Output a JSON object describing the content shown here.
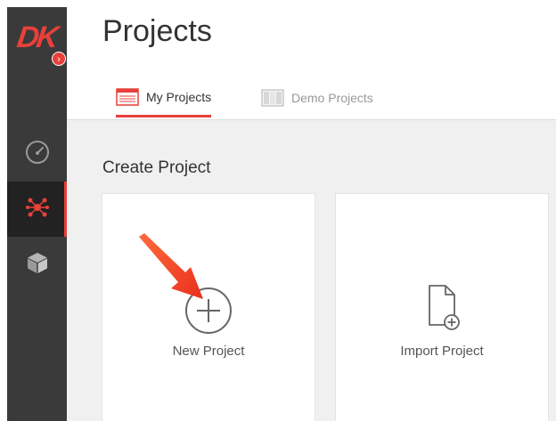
{
  "sidebar": {
    "logo_text": "DK",
    "collapse_icon": "chevron-right-icon",
    "items": [
      {
        "name": "dashboard",
        "icon": "speedometer-icon",
        "active": false
      },
      {
        "name": "projects",
        "icon": "network-nodes-icon",
        "active": true
      },
      {
        "name": "models",
        "icon": "cube-icon",
        "active": false
      }
    ]
  },
  "header": {
    "title": "Projects",
    "tabs": [
      {
        "label": "My Projects",
        "icon": "table-icon",
        "active": true
      },
      {
        "label": "Demo Projects",
        "icon": "columns-icon",
        "active": false
      }
    ]
  },
  "main": {
    "section_title": "Create Project",
    "cards": [
      {
        "label": "New Project",
        "icon": "plus-circle-icon"
      },
      {
        "label": "Import Project",
        "icon": "file-plus-icon"
      }
    ]
  },
  "colors": {
    "accent": "#e8403a",
    "sidebar": "#3a3a3a",
    "background": "#f0f0f0"
  }
}
